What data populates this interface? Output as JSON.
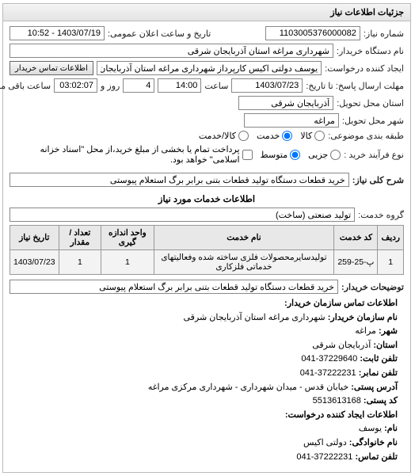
{
  "panel_title": "جزئیات اطلاعات نیاز",
  "header": {
    "labels": {
      "need_no": "شماره نیاز:",
      "public_datetime": "تاریخ و ساعت اعلان عمومی:",
      "buyer_device": "نام دستگاه خریدار:",
      "requester": "ایجاد کننده درخواست:",
      "reply_until": "مهلت ارسال پاسخ: تا تاریخ:",
      "hour": "ساعت",
      "day_and": "روز و",
      "hour_remaining": "ساعت باقی مانده",
      "delivery_province": "استان محل تحویل:",
      "delivery_city": "شهر محل تحویل:",
      "subject_category": "طبقه بندی موضوعی:",
      "process_type": "نوع فرآیند خرید :",
      "contact_btn": "اطلاعات تماس خریدار",
      "need_desc": "شرح کلی نیاز:"
    },
    "values": {
      "need_no": "1103005376000082",
      "public_datetime": "1403/07/19 - 10:52",
      "buyer_device": "شهرداری مراغه استان آذربایجان شرقی",
      "requester": "یوسف دولتی اکیس کارپرداز شهرداری مراغه استان آذربایجان شرقی",
      "reply_until": "1403/07/23",
      "reply_hour": "14:00",
      "days_left": "4",
      "hours_left": "03:02:07",
      "delivery_province": "آذربایجان شرقی",
      "delivery_city": "مراغه",
      "need_desc": "خرید قطعات دستگاه تولید قطعات بتنی برابر برگ استعلام پیوستی"
    },
    "subject_options": {
      "goods": "کالا",
      "service": "خدمت",
      "goods_service": "کالا/خدمت"
    },
    "process_options": {
      "small": "جزیی",
      "medium": "متوسط",
      "process_note": "پرداخت تمام یا بخشی از مبلغ خرید،از محل \"اسناد خزانه اسلامی\" خواهد بود."
    }
  },
  "services_section": {
    "title": "اطلاعات خدمات مورد نیاز",
    "group_label": "گروه خدمت:",
    "group_value": "تولید صنعتی (ساخت)",
    "table": {
      "headers": {
        "row": "ردیف",
        "code": "کد خدمت",
        "name": "نام خدمت",
        "unit": "واحد اندازه گیری",
        "qty": "تعداد / مقدار",
        "date": "تاریخ نیاز"
      },
      "rows": [
        {
          "row": "1",
          "code": "پ-25-259",
          "name": "تولیدسایرمحصولات فلزی ساخته شده وفعالیتهای خدماتی فلزکاری",
          "unit": "1",
          "qty": "1",
          "date": "1403/07/23"
        }
      ]
    },
    "buyer_notes_label": "توضیحات خریدار:",
    "buyer_notes_value": "خرید قطعات دستگاه تولید قطعات بتنی برابر برگ استعلام پیوستی"
  },
  "contact_section": {
    "title": "اطلاعات تماس سازمان خریدار:",
    "org_name_label": "نام سازمان خریدار:",
    "org_name": "شهرداری مراغه استان آذربایجان شرقی",
    "city_label": "شهر:",
    "city": "مراغه",
    "province_label": "استان:",
    "province": "آذربایجان شرقی",
    "phone_number_label": "تلفن ثابت:",
    "phone_number": "37229640-041",
    "fax_label": "تلفن نمابر:",
    "fax": "37222231-041",
    "postal_address_label": "آدرس پستی:",
    "postal_address": "خیابان قدس - میدان شهرداری - شهرداری مرکزی مراغه",
    "postal_code_label": "کد پستی:",
    "postal_code": "5513613168",
    "requester_info_title": "اطلاعات ایجاد کننده درخواست:",
    "name_label": "نام:",
    "name": "یوسف",
    "surname_label": "نام خانوادگی:",
    "surname": "دولتی اکیس",
    "phone_label": "تلفن تماس:",
    "phone": "37222231-041"
  }
}
